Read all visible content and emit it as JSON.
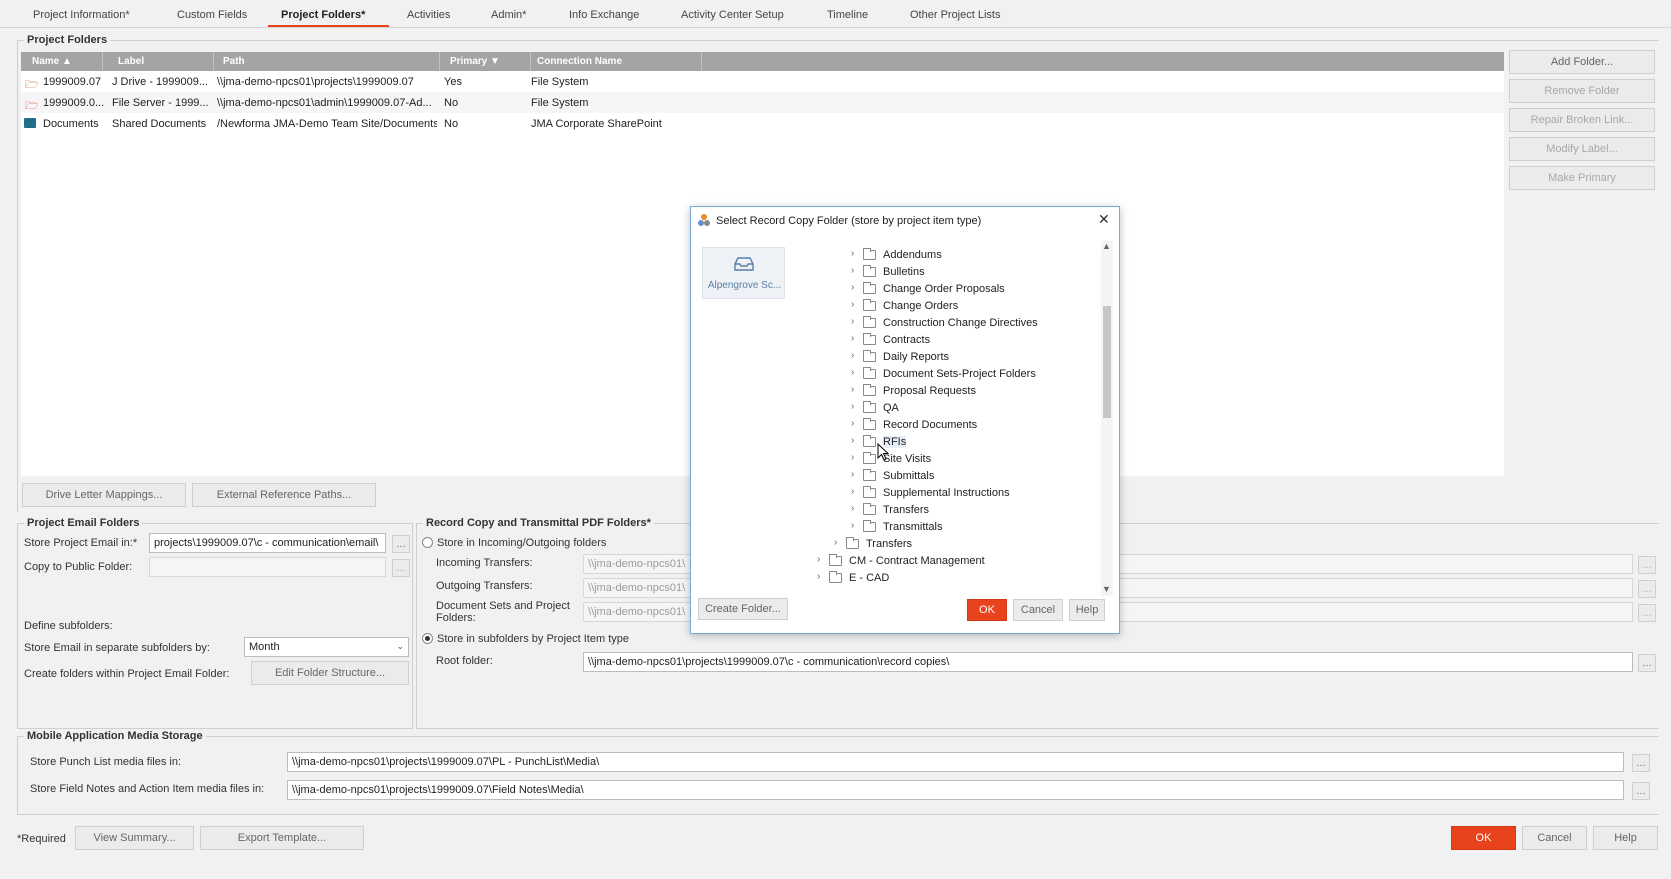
{
  "tabs": [
    {
      "label": "Project Information*"
    },
    {
      "label": "Custom Fields"
    },
    {
      "label": "Project Folders*"
    },
    {
      "label": "Activities"
    },
    {
      "label": "Admin*"
    },
    {
      "label": "Info Exchange"
    },
    {
      "label": "Activity Center Setup"
    },
    {
      "label": "Timeline"
    },
    {
      "label": "Other Project Lists"
    }
  ],
  "project_folders": {
    "title": "Project Folders",
    "columns": {
      "name": "Name",
      "label": "Label",
      "path": "Path",
      "primary": "Primary",
      "connection": "Connection Name"
    },
    "rows": [
      {
        "name": "1999009.07",
        "label": "J Drive - 1999009...",
        "path": "\\\\jma-demo-npcs01\\projects\\1999009.07",
        "primary": "Yes",
        "connection": "File System",
        "icon": "folder-open-icon"
      },
      {
        "name": "1999009.0...",
        "label": "File Server - 1999...",
        "path": "\\\\jma-demo-npcs01\\admin\\1999009.07-Ad...",
        "primary": "No",
        "connection": "File System",
        "icon": "folder-open-icon"
      },
      {
        "name": "Documents",
        "label": "Shared Documents",
        "path": "/Newforma JMA-Demo Team Site/Documents",
        "primary": "No",
        "connection": "JMA Corporate SharePoint",
        "icon": "sharepoint-folder-icon"
      }
    ],
    "buttons": {
      "add": "Add Folder...",
      "remove": "Remove Folder",
      "repair": "Repair Broken Link...",
      "modify": "Modify Label...",
      "primary": "Make Primary",
      "drive_letter": "Drive Letter Mappings...",
      "external_ref": "External Reference Paths..."
    }
  },
  "email_folders": {
    "title": "Project Email Folders",
    "store_label": "Store Project Email in:*",
    "store_value": "projects\\1999009.07\\c - communication\\email\\",
    "public_label": "Copy to Public Folder:",
    "public_value": "",
    "define_subfolders": "Define subfolders:",
    "separate_label": "Store Email in separate subfolders by:",
    "separate_value": "Month",
    "create_label": "Create folders within Project Email Folder:",
    "edit_structure": "Edit Folder Structure..."
  },
  "record_copy": {
    "title": "Record Copy and Transmittal PDF Folders*",
    "option_incoming": "Store in Incoming/Outgoing folders",
    "incoming_label": "Incoming Transfers:",
    "incoming_value": "\\\\jma-demo-npcs01\\",
    "outgoing_label": "Outgoing Transfers:",
    "outgoing_value": "\\\\jma-demo-npcs01\\",
    "docsets_label": "Document Sets and Project Folders:",
    "docsets_value": "\\\\jma-demo-npcs01\\",
    "option_item_type": "Store in subfolders by Project Item type",
    "root_label": "Root folder:",
    "root_value": "\\\\jma-demo-npcs01\\projects\\1999009.07\\c - communication\\record copies\\"
  },
  "mobile": {
    "title": "Mobile Application Media Storage",
    "punch_label": "Store Punch List media files in:",
    "punch_value": "\\\\jma-demo-npcs01\\projects\\1999009.07\\PL - PunchList\\Media\\",
    "field_label": "Store Field Notes and Action Item media files in:",
    "field_value": "\\\\jma-demo-npcs01\\projects\\1999009.07\\Field Notes\\Media\\"
  },
  "footer": {
    "required": "*Required",
    "view_summary": "View Summary...",
    "export_template": "Export Template...",
    "ok": "OK",
    "cancel": "Cancel",
    "help": "Help"
  },
  "dialog": {
    "title": "Select Record Copy Folder (store by project item type)",
    "side_item": "Alpengrove Sc...",
    "tree": [
      {
        "label": "Addendums",
        "level": 2
      },
      {
        "label": "Bulletins",
        "level": 2
      },
      {
        "label": "Change Order Proposals",
        "level": 2
      },
      {
        "label": "Change Orders",
        "level": 2
      },
      {
        "label": "Construction Change Directives",
        "level": 2
      },
      {
        "label": "Contracts",
        "level": 2
      },
      {
        "label": "Daily Reports",
        "level": 2
      },
      {
        "label": "Document Sets-Project Folders",
        "level": 2
      },
      {
        "label": "Proposal Requests",
        "level": 2
      },
      {
        "label": "QA",
        "level": 2
      },
      {
        "label": "Record Documents",
        "level": 2
      },
      {
        "label": "RFIs",
        "level": 2
      },
      {
        "label": "Site Visits",
        "level": 2
      },
      {
        "label": "Submittals",
        "level": 2
      },
      {
        "label": "Supplemental Instructions",
        "level": 2
      },
      {
        "label": "Transfers",
        "level": 2
      },
      {
        "label": "Transmittals",
        "level": 2
      },
      {
        "label": "Transfers",
        "level": 1
      },
      {
        "label": "CM - Contract Management",
        "level": 0
      },
      {
        "label": "E - CAD",
        "level": 0
      }
    ],
    "create_folder": "Create Folder...",
    "ok": "OK",
    "cancel": "Cancel",
    "help": "Help"
  }
}
